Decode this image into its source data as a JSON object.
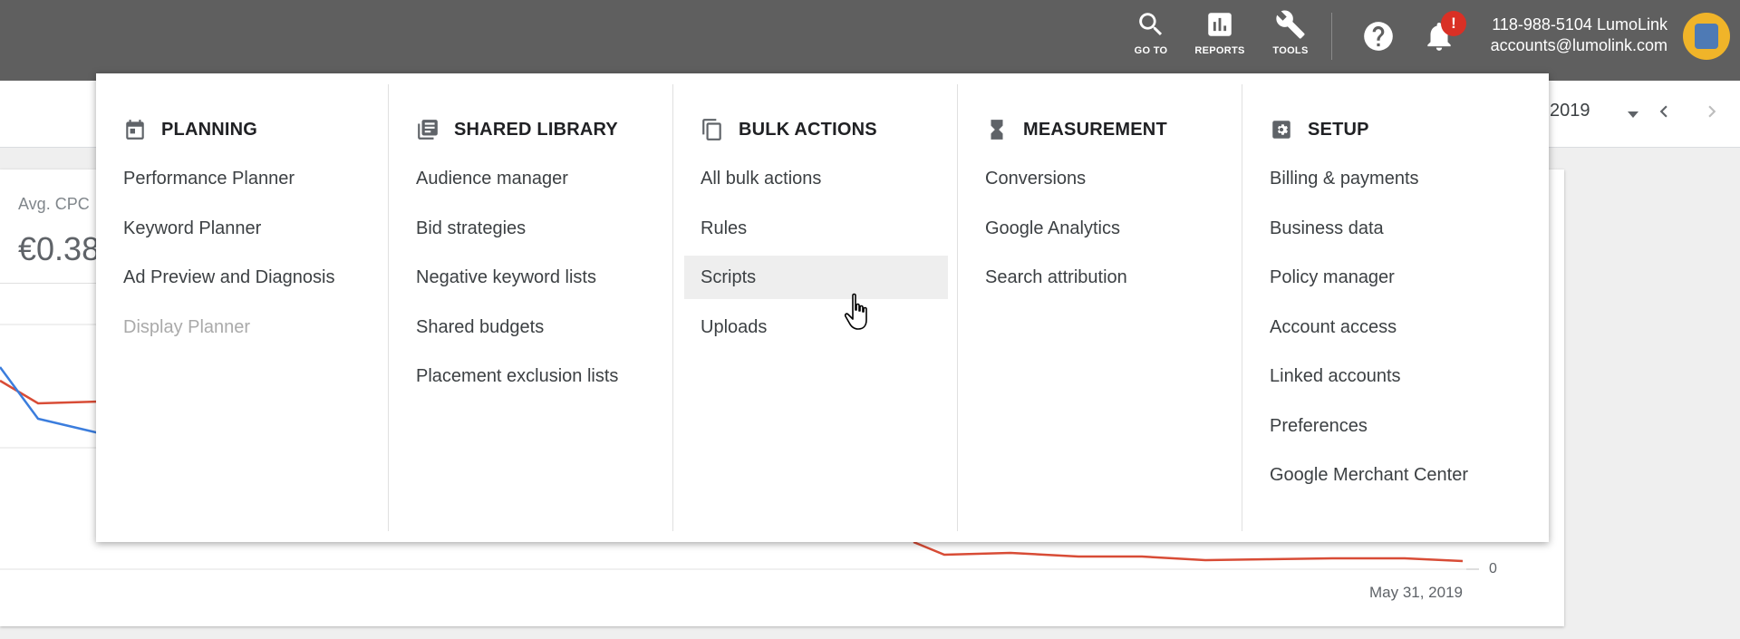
{
  "topbar": {
    "goto_label": "GO TO",
    "reports_label": "REPORTS",
    "tools_label": "TOOLS",
    "notification_badge": "!",
    "account_line1": "118-988-5104 LumoLink",
    "account_line2": "accounts@lumolink.com",
    "icons": [
      "search-icon",
      "bar-chart-icon",
      "wrench-icon",
      "help-icon",
      "bell-icon",
      "avatar"
    ]
  },
  "date_range": {
    "text": "2019",
    "icons": [
      "dropdown-caret-icon",
      "chevron-left-icon",
      "chevron-right-icon"
    ]
  },
  "background_card": {
    "metric_label": "Avg. CPC",
    "metric_value": "€0.38",
    "axis_zero": "0",
    "axis_date": "May 31, 2019",
    "series_colors": [
      "#d84c36",
      "#3b7ddd"
    ]
  },
  "tools_menu": {
    "columns": [
      {
        "title": "PLANNING",
        "icon": "calendar-icon",
        "items": [
          {
            "label": "Performance Planner"
          },
          {
            "label": "Keyword Planner"
          },
          {
            "label": "Ad Preview and Diagnosis"
          },
          {
            "label": "Display Planner",
            "disabled": true
          }
        ]
      },
      {
        "title": "SHARED LIBRARY",
        "icon": "library-icon",
        "items": [
          {
            "label": "Audience manager"
          },
          {
            "label": "Bid strategies"
          },
          {
            "label": "Negative keyword lists"
          },
          {
            "label": "Shared budgets"
          },
          {
            "label": "Placement exclusion lists"
          }
        ]
      },
      {
        "title": "BULK ACTIONS",
        "icon": "copy-icon",
        "items": [
          {
            "label": "All bulk actions"
          },
          {
            "label": "Rules"
          },
          {
            "label": "Scripts",
            "hover": true
          },
          {
            "label": "Uploads"
          }
        ]
      },
      {
        "title": "MEASUREMENT",
        "icon": "hourglass-icon",
        "items": [
          {
            "label": "Conversions"
          },
          {
            "label": "Google Analytics"
          },
          {
            "label": "Search attribution"
          }
        ]
      },
      {
        "title": "SETUP",
        "icon": "settings-icon",
        "items": [
          {
            "label": "Billing & payments"
          },
          {
            "label": "Business data"
          },
          {
            "label": "Policy manager"
          },
          {
            "label": "Account access"
          },
          {
            "label": "Linked accounts"
          },
          {
            "label": "Preferences"
          },
          {
            "label": "Google Merchant Center"
          }
        ]
      }
    ]
  },
  "colors": {
    "topbar": "#5f5f5f",
    "badge": "#d93025",
    "hover_row": "#eeeeee"
  }
}
